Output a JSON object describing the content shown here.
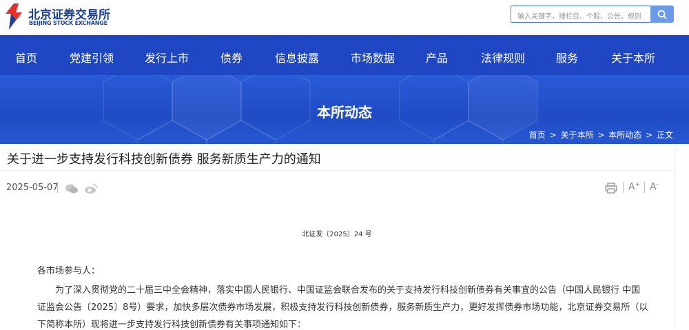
{
  "header": {
    "logo_cn": "北京证券交易所",
    "logo_en": "BEIJING STOCK EXCHANGE",
    "search_placeholder": "输入关键字，搜栏目、个股、公告、规则",
    "brand_red": "#e5302c",
    "brand_blue": "#1b3f95"
  },
  "nav": {
    "items": [
      "首页",
      "党建引领",
      "发行上市",
      "债券",
      "信息披露",
      "市场数据",
      "产品",
      "法律规则",
      "服务",
      "关于本所"
    ],
    "color": "#2047c3"
  },
  "banner": {
    "title": "本所动态",
    "breadcrumb": [
      "首页",
      "关于本所",
      "本所动态",
      "正文"
    ],
    "separator": ">"
  },
  "article": {
    "title": "关于进一步支持发行科技创新债券 服务新质生产力的通知",
    "date": "2025-05-07",
    "share_icons": [
      "wechat-icon",
      "weibo-icon"
    ],
    "tools": {
      "print": "print-icon",
      "font_larger": "A",
      "font_smaller": "A"
    },
    "doc_number": "北证发〔2025〕24 号",
    "salutation": "各市场参与人：",
    "body_lines": [
      "为了深入贯彻党的二十届三中全会精神，落实中国人民银行、中国证监会联合发布的关于支持发行科技创新债券有关事宜的公告（中国人民银行 中国",
      "证监会公告〔2025〕8号）要求，加快多层次债券市场发展，积极支持发行科技创新债券，服务新质生产力，更好发挥债券市场功能，北京证券交易所（以",
      "下简称本所）现将进一步支持发行科技创新债券有关事项通知如下："
    ]
  }
}
